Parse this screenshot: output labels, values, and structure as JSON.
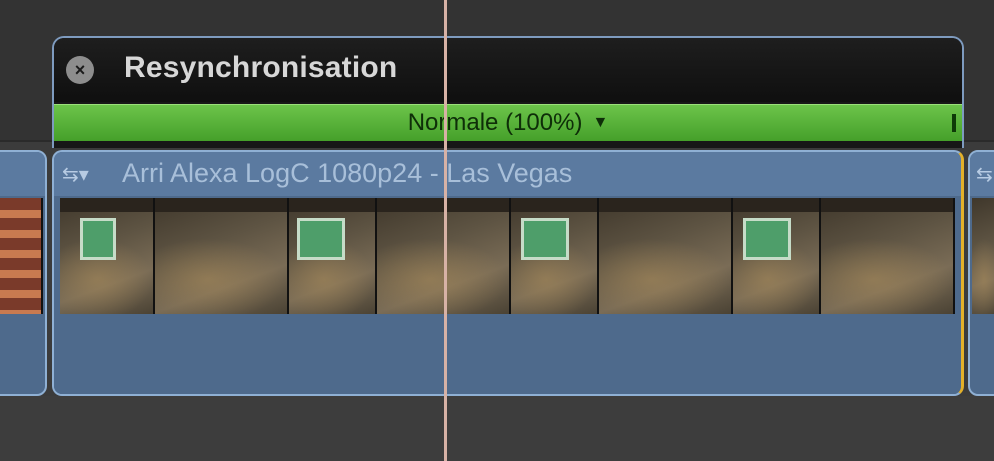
{
  "retime": {
    "title": "Resynchronisation",
    "speed_label": "Normale (100%)",
    "speed_arrow": "▼",
    "close_glyph": "×"
  },
  "clip": {
    "title": "Arri Alexa LogC 1080p24 - Las Vegas",
    "menu_icon": "⇆▾"
  },
  "colors": {
    "speed_bar": "#5ab43a",
    "clip_blue": "#4e6a8c",
    "trim_handle": "#e3b02a",
    "playhead": "#d7b2a6"
  }
}
